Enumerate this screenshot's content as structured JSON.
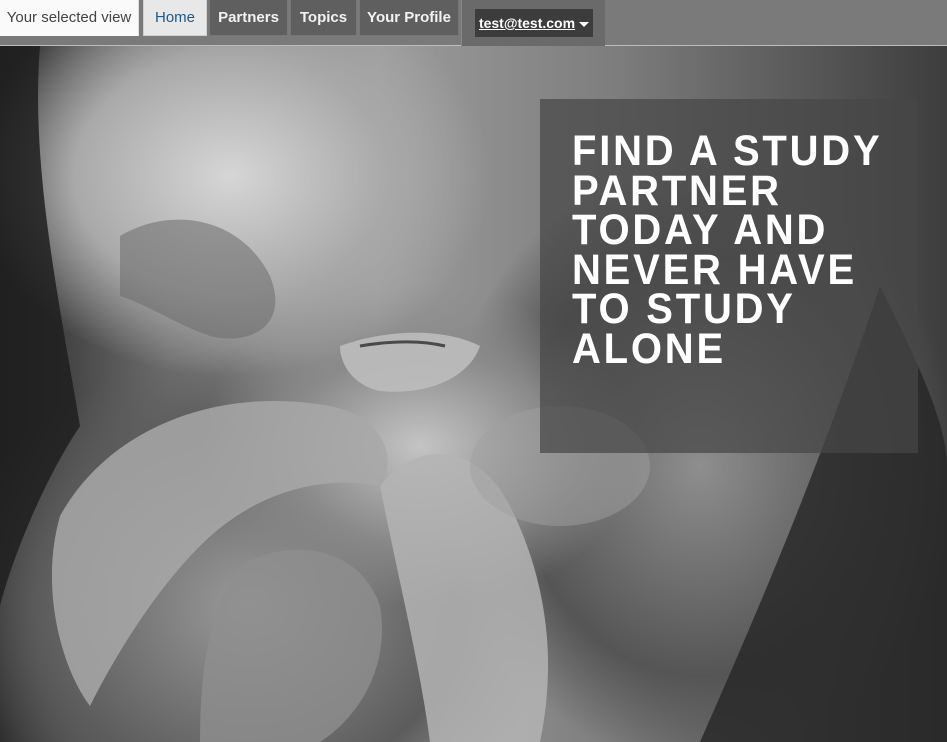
{
  "nav": {
    "selected_view_label": "Your selected view",
    "tabs": [
      {
        "label": "Home"
      },
      {
        "label": "Partners"
      },
      {
        "label": "Topics"
      },
      {
        "label": "Your Profile"
      }
    ],
    "account": {
      "email": "test@test.com",
      "icon": "caret-down-icon"
    }
  },
  "hero": {
    "headline": "FIND A STUDY PARTNER TODAY AND NEVER HAVE TO STUDY ALONE",
    "image_alt_present": false
  }
}
